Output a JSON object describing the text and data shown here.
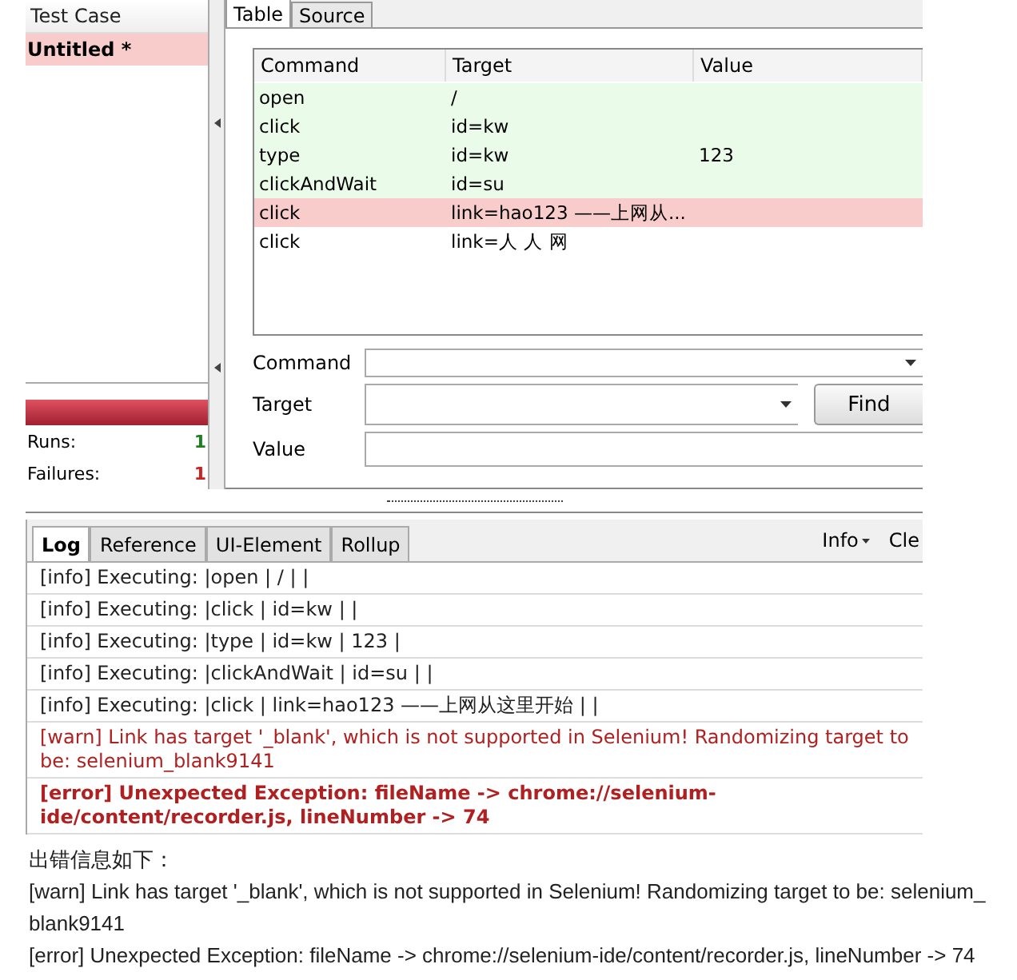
{
  "test_case_panel": {
    "header": "Test Case",
    "items": [
      {
        "label": "Untitled *",
        "selected": true
      }
    ],
    "progress": {
      "level": 1,
      "failed": true
    },
    "stats": [
      {
        "label": "Runs:",
        "value": "1",
        "kind": "runs"
      },
      {
        "label": "Failures:",
        "value": "1",
        "kind": "failures"
      }
    ]
  },
  "editor_tabs": [
    {
      "label": "Table",
      "selected": true
    },
    {
      "label": "Source",
      "selected": false
    }
  ],
  "table": {
    "columns": [
      "Command",
      "Target",
      "Value"
    ],
    "rows": [
      {
        "command": "open",
        "target": "/",
        "kind": "passed"
      },
      {
        "command": "click",
        "target": "id=kw",
        "kind": "passed"
      },
      {
        "command": "type",
        "target": "id=kw",
        "value": "123",
        "kind": "passed"
      },
      {
        "command": "clickAndWait",
        "target": "id=su",
        "kind": "passed"
      },
      {
        "command": "click",
        "target": "link=hao123 ——上网从...",
        "kind": "failed"
      },
      {
        "command": "click",
        "target": "link=人 人 网",
        "kind": "pending"
      }
    ]
  },
  "form": {
    "fields": [
      {
        "label": "Command",
        "kind": "combo"
      },
      {
        "label": "Target",
        "kind": "select"
      },
      {
        "label": "Value",
        "kind": "text"
      }
    ],
    "find_button": "Find"
  },
  "log_tabs": [
    {
      "label": "Log",
      "selected": true
    },
    {
      "label": "Reference",
      "selected": false
    },
    {
      "label": "UI-Element",
      "selected": false
    },
    {
      "label": "Rollup",
      "selected": false
    }
  ],
  "log_tools": [
    "Info",
    "Cle"
  ],
  "log_entries": [
    {
      "kind": "info",
      "text": "[info] Executing: |open | / | |"
    },
    {
      "kind": "info",
      "text": "[info] Executing: |click | id=kw | |"
    },
    {
      "kind": "info",
      "text": "[info] Executing: |type | id=kw | 123 |"
    },
    {
      "kind": "info",
      "text": "[info] Executing: |clickAndWait | id=su | |"
    },
    {
      "kind": "info",
      "text": "[info] Executing: |click | link=hao123 ——上网从这里开始 | |"
    },
    {
      "kind": "warn",
      "text": "[warn] Link has target '_blank', which is not supported in Selenium! Randomizing target to be: selenium_blank9141"
    },
    {
      "kind": "error",
      "text": "[error] Unexpected Exception: fileName -> chrome://selenium-ide/content/recorder.js, lineNumber -> 74"
    }
  ],
  "article": {
    "heading": "出错信息如下：",
    "paragraphs": [
      "[warn] Link has target '_blank', which is not supported in Selenium! Randomizing target to be: selenium_blank9141",
      "[error] Unexpected Exception: fileName -> chrome://selenium-ide/content/recorder.js, lineNumber -> 74"
    ]
  }
}
